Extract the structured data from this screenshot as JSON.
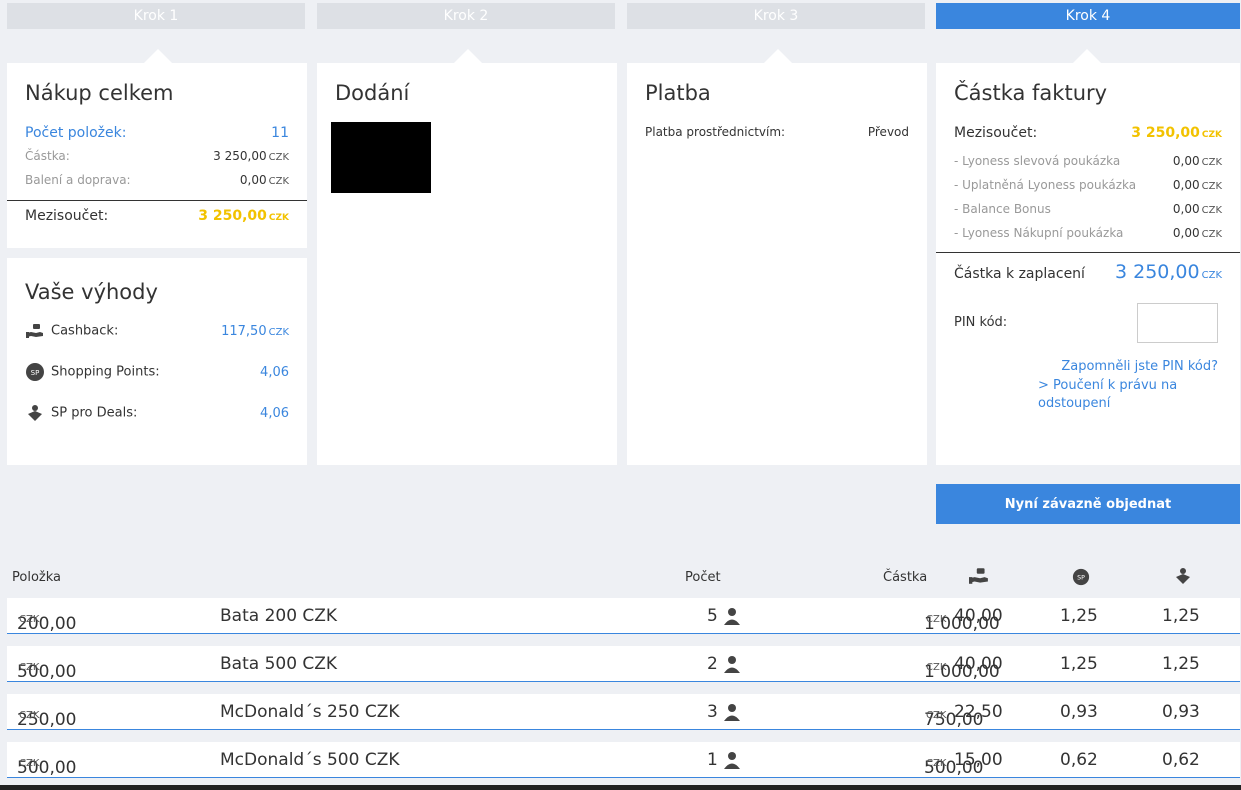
{
  "steps": [
    "Krok 1",
    "Krok 2",
    "Krok 3",
    "Krok 4"
  ],
  "summary": {
    "title": "Nákup celkem",
    "items_label": "Počet položek:",
    "items_value": "11",
    "amount_label": "Částka:",
    "amount_value": "3 250,00",
    "shipping_label": "Balení a doprava:",
    "shipping_value": "0,00",
    "subtotal_label": "Mezisoučet:",
    "subtotal_value": "3 250,00",
    "currency": "CZK"
  },
  "benefits": {
    "title": "Vaše výhody",
    "cashback_label": "Cashback:",
    "cashback_value": "117,50",
    "sp_label": "Shopping Points:",
    "sp_value": "4,06",
    "deals_label": "SP pro Deals:",
    "deals_value": "4,06",
    "sp_icon_text": "SP"
  },
  "delivery": {
    "title": "Dodání"
  },
  "payment": {
    "title": "Platba",
    "method_label": "Platba prostřednictvím:",
    "method_value": "Převod"
  },
  "invoice": {
    "title": "Částka faktury",
    "subtotal_label": "Mezisoučet:",
    "subtotal_value": "3 250,00",
    "lines": [
      {
        "label": "- Lyoness slevová poukázka",
        "value": "0,00"
      },
      {
        "label": "- Uplatněná Lyoness poukázka",
        "value": "0,00"
      },
      {
        "label": "- Balance Bonus",
        "value": "0,00"
      },
      {
        "label": "- Lyoness Nákupní poukázka",
        "value": "0,00"
      }
    ],
    "to_pay_label": "Částka k zaplacení",
    "to_pay_value": "3 250,00",
    "pin_label": "PIN kód:",
    "forgot_pin": "Zapomněli jste PIN kód?",
    "withdrawal_link": "> Poučení k právu na odstoupení",
    "currency": "CZK"
  },
  "order_button": "Nyní závazně objednat",
  "table": {
    "headers": {
      "item": "Položka",
      "count": "Počet",
      "amount": "Částka",
      "sp_icon_text": "SP"
    },
    "rows": [
      {
        "price": "200,00",
        "name": "Bata 200 CZK",
        "count": "5",
        "amount": "1 000,00",
        "cashback": "40,00",
        "sp": "1,25",
        "deals": "1,25"
      },
      {
        "price": "500,00",
        "name": "Bata 500 CZK",
        "count": "2",
        "amount": "1 000,00",
        "cashback": "40,00",
        "sp": "1,25",
        "deals": "1,25"
      },
      {
        "price": "250,00",
        "name": "McDonald´s 250 CZK",
        "count": "3",
        "amount": "750,00",
        "cashback": "22,50",
        "sp": "0,93",
        "deals": "0,93"
      },
      {
        "price": "500,00",
        "name": "McDonald´s 500 CZK",
        "count": "1",
        "amount": "500,00",
        "cashback": "15,00",
        "sp": "0,62",
        "deals": "0,62"
      }
    ],
    "currency": "CZK"
  },
  "colors": {
    "accent": "#3a86de",
    "gold": "#f2c200",
    "step_inactive": "#dde0e5",
    "background": "#eef0f4"
  }
}
